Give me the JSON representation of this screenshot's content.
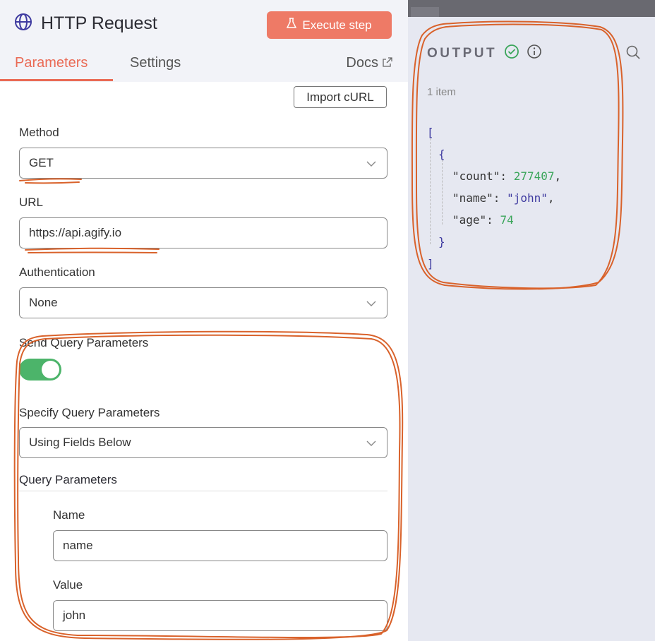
{
  "header": {
    "title": "HTTP Request",
    "execute_label": "Execute step"
  },
  "tabs": {
    "parameters": "Parameters",
    "settings": "Settings",
    "docs": "Docs"
  },
  "import_curl": "Import cURL",
  "form": {
    "method_label": "Method",
    "method_value": "GET",
    "url_label": "URL",
    "url_value": "https://api.agify.io",
    "auth_label": "Authentication",
    "auth_value": "None",
    "send_query_label": "Send Query Parameters",
    "send_query_enabled": true,
    "specify_label": "Specify Query Parameters",
    "specify_value": "Using Fields Below",
    "query_section": "Query Parameters",
    "name_label": "Name",
    "name_value": "name",
    "value_label": "Value",
    "value_value": "john"
  },
  "output": {
    "title": "OUTPUT",
    "item_count": "1 item",
    "json": {
      "count_key": "\"count\":",
      "count_val": "277407",
      "name_key": "\"name\":",
      "name_val": "\"john\"",
      "age_key": "\"age\":",
      "age_val": "74"
    }
  },
  "colors": {
    "accent": "#ea6a55",
    "execute_bg": "#ee7a66",
    "toggle_on": "#4cb46a",
    "annotation": "#d9622b",
    "output_bg": "#e6e8f1"
  }
}
